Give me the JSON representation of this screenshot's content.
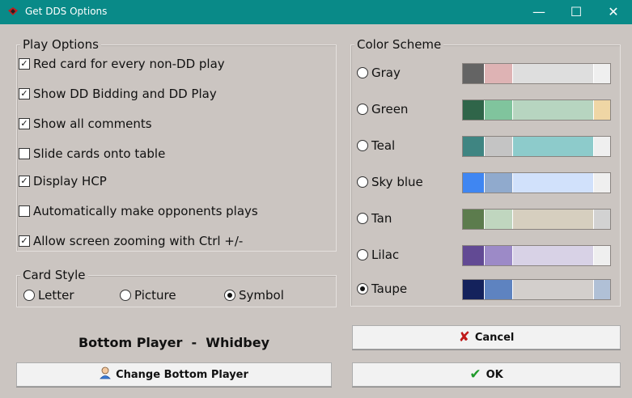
{
  "window": {
    "title": "Get DDS Options",
    "minimize_glyph": "—",
    "maximize_glyph": "☐",
    "close_glyph": "✕"
  },
  "play_options": {
    "legend": "Play Options",
    "items": [
      {
        "label": "Red card for every non-DD play",
        "checked": true
      },
      {
        "label": "Show DD Bidding and DD Play",
        "checked": true
      },
      {
        "label": "Show all comments",
        "checked": true
      },
      {
        "label": "Slide cards onto table",
        "checked": false
      },
      {
        "label": "Display HCP",
        "checked": true
      },
      {
        "label": "Automatically make opponents plays",
        "checked": false
      },
      {
        "label": "Allow screen zooming with Ctrl +/-",
        "checked": true
      }
    ]
  },
  "card_style": {
    "legend": "Card Style",
    "options": [
      {
        "label": "Letter",
        "selected": false
      },
      {
        "label": "Picture",
        "selected": false
      },
      {
        "label": "Symbol",
        "selected": true
      }
    ]
  },
  "color_scheme": {
    "legend": "Color Scheme",
    "schemes": [
      {
        "label": "Gray",
        "selected": false,
        "colors": [
          "#646464",
          "#deb3b4",
          "#dedede",
          "#efefef"
        ]
      },
      {
        "label": "Green",
        "selected": false,
        "colors": [
          "#2f6549",
          "#80c49d",
          "#b7d5c0",
          "#efd6a5"
        ]
      },
      {
        "label": "Teal",
        "selected": false,
        "colors": [
          "#3f8582",
          "#c4c4c4",
          "#8dcbcb",
          "#efefef"
        ]
      },
      {
        "label": "Sky blue",
        "selected": false,
        "colors": [
          "#3f86f2",
          "#90aacd",
          "#d1e1fb",
          "#efefef"
        ]
      },
      {
        "label": "Tan",
        "selected": false,
        "colors": [
          "#5c7c4d",
          "#c0d6bf",
          "#d6cfbf",
          "#d2d2d2"
        ]
      },
      {
        "label": "Lilac",
        "selected": false,
        "colors": [
          "#624a94",
          "#9c8ac7",
          "#d8d2e6",
          "#efefef"
        ]
      },
      {
        "label": "Taupe",
        "selected": true,
        "colors": [
          "#14225c",
          "#5e83c0",
          "#d3cfcc",
          "#b0c0d6"
        ]
      }
    ]
  },
  "bottom_player": {
    "text": "Bottom Player  -  Whidbey"
  },
  "buttons": {
    "change_bottom_player": "Change Bottom Player",
    "cancel": "Cancel",
    "ok": "OK"
  },
  "icons": {
    "app": "cards-icon",
    "person": "person-icon",
    "cancel": "red-x-icon",
    "ok": "green-check-icon"
  }
}
